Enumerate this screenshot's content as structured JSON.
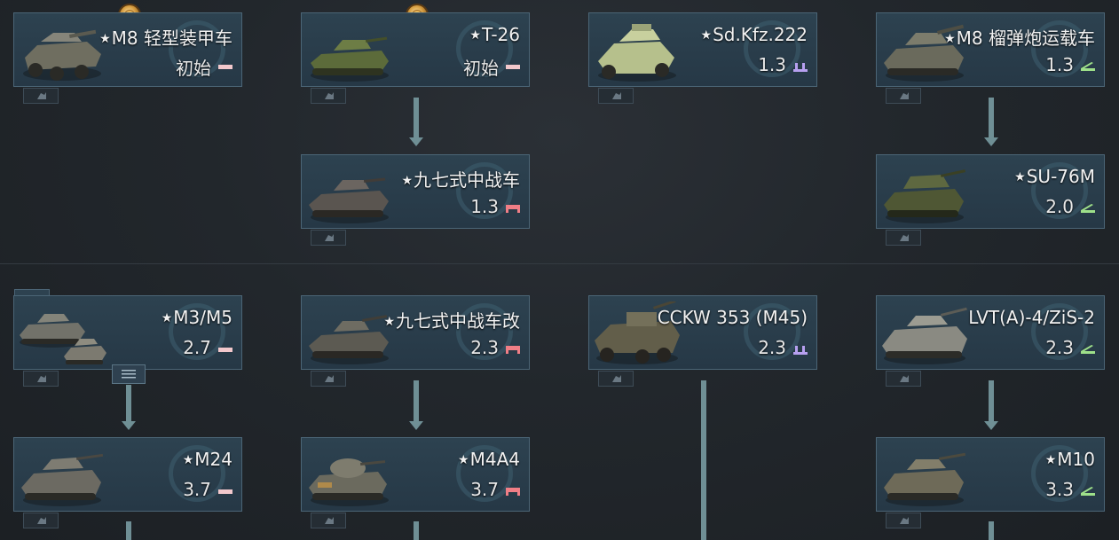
{
  "colors": {
    "card_bg": "#2d4250",
    "card_border": "#4b6576",
    "arrow": "#6f8f95",
    "role_light_tank": "#f2c8cc",
    "role_medium_tank": "#f07e86",
    "role_spaa": "#b7a0f0",
    "role_tank_destroyer": "#9ee08a"
  },
  "ranks": [
    "rank-1",
    "rank-2"
  ],
  "vehicles": [
    {
      "id": "m8-lac",
      "name": "M8 轻型装甲车",
      "br": "初始",
      "role": "light-tank-icon",
      "medal": true
    },
    {
      "id": "t-26",
      "name": "T-26",
      "br": "初始",
      "role": "light-tank-icon",
      "medal": true
    },
    {
      "id": "sdkfz-222",
      "name": "Sd.Kfz.222",
      "br": "1.3",
      "role": "spaa-icon",
      "medal": false
    },
    {
      "id": "m8-hmc",
      "name": "M8 榴弹炮运载车",
      "br": "1.3",
      "role": "tank-destroyer-icon",
      "medal": false
    },
    {
      "id": "type97",
      "name": "九七式中战车",
      "br": "1.3",
      "role": "medium-tank-icon",
      "medal": false
    },
    {
      "id": "su-76m",
      "name": "SU-76M",
      "br": "2.0",
      "role": "tank-destroyer-icon",
      "medal": false
    },
    {
      "id": "m3-m5",
      "name": "M3/M5",
      "br": "2.7",
      "role": "light-tank-icon",
      "medal": false
    },
    {
      "id": "type97-kai",
      "name": "九七式中战车改",
      "br": "2.3",
      "role": "medium-tank-icon",
      "medal": false
    },
    {
      "id": "cckw",
      "name": "CCKW 353 (M45)",
      "br": "2.3",
      "role": "spaa-icon",
      "medal": false
    },
    {
      "id": "lvt",
      "name": "LVT(A)-4/ZiS-2",
      "br": "2.3",
      "role": "tank-destroyer-icon",
      "medal": false
    },
    {
      "id": "m24",
      "name": "M24",
      "br": "3.7",
      "role": "light-tank-icon",
      "medal": false
    },
    {
      "id": "m4a4",
      "name": "M4A4",
      "br": "3.7",
      "role": "medium-tank-icon",
      "medal": false
    },
    {
      "id": "m10",
      "name": "M10",
      "br": "3.3",
      "role": "tank-destroyer-icon",
      "medal": false
    }
  ],
  "icons": {
    "prefix": "star-icon",
    "star_glyph": "★",
    "vehicle_type_tag": "crew-tag-icon",
    "medal": "medal-icon",
    "group_button": "folder-expand-icon"
  }
}
